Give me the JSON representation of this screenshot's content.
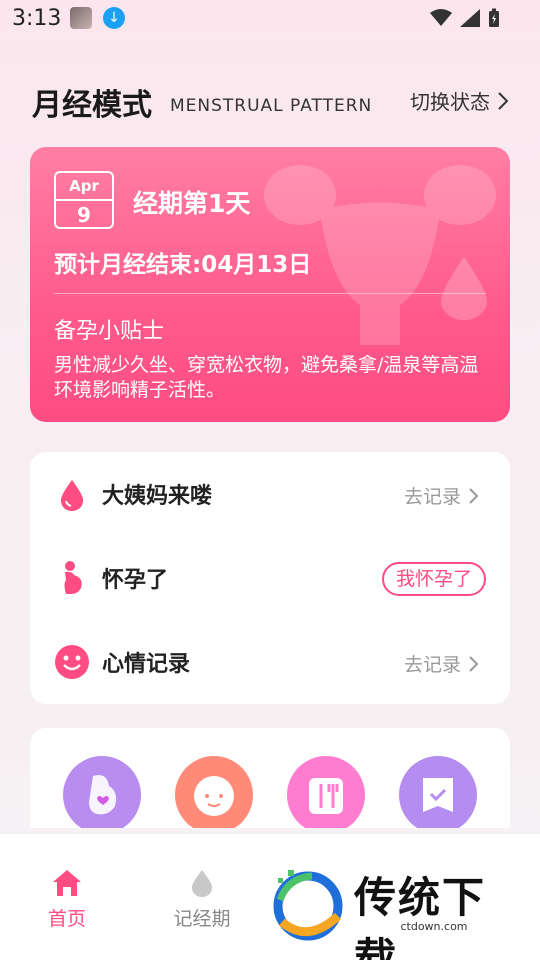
{
  "status_bar": {
    "time": "3:13"
  },
  "header": {
    "title": "月经模式",
    "subtitle": "MENSTRUAL PATTERN",
    "switch_label": "切换状态"
  },
  "period_card": {
    "calendar_month": "Apr",
    "calendar_day": "9",
    "period_day": "经期第1天",
    "expected_end": "预计月经结束:04月13日",
    "tip_title": "备孕小贴士",
    "tip_text": "男性减少久坐、穿宽松衣物，避免桑拿/温泉等高温环境影响精子活性。"
  },
  "records": [
    {
      "icon": "drop-icon",
      "label": "大姨妈来喽",
      "action": "去记录"
    },
    {
      "icon": "pregnant-icon",
      "label": "怀孕了",
      "action": "我怀孕了"
    },
    {
      "icon": "smile-icon",
      "label": "心情记录",
      "action": "去记录"
    }
  ],
  "tools": [
    {
      "icon": "pregnancy-tool-icon",
      "color": "#b98cf0"
    },
    {
      "icon": "baby-tool-icon",
      "color": "#ff8a78"
    },
    {
      "icon": "food-tool-icon",
      "color": "#ff7ccf"
    },
    {
      "icon": "checklist-tool-icon",
      "color": "#b58cf0"
    }
  ],
  "bottom_nav": [
    {
      "icon": "home-icon",
      "label": "首页",
      "active": true
    },
    {
      "icon": "drop-icon",
      "label": "记经期",
      "active": false
    }
  ],
  "watermark": {
    "title": "传统下载",
    "url": "ctdown.com"
  },
  "colors": {
    "accent": "#ff4c83",
    "card_top": "#ff7ea4",
    "card_bottom": "#ff4c83"
  }
}
